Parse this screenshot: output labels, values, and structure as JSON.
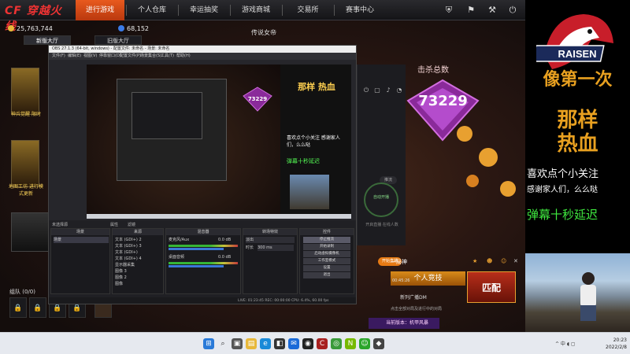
{
  "game": {
    "logo_text": "CF 穿越火线",
    "nav_tabs": [
      "进行游戏",
      "个人仓库",
      "幸运抽奖",
      "游戏商城",
      "交易所",
      "赛事中心"
    ],
    "active_tab_index": 0,
    "top_icons": [
      "shield-icon",
      "flag-icon",
      "wrench-icon",
      "power-icon"
    ],
    "currency": {
      "coins": "25,763,744",
      "points": "68,152"
    },
    "center_title": "传说女帝",
    "sub_tabs": [
      "新版大厅",
      "旧版大厅"
    ],
    "promo_1": "神兵觉醒\n限时",
    "promo_2": "地图工坊\n进行模式更新",
    "team_label": "组队 (0/0)",
    "kills_label": "击杀总数",
    "kills_value": "73229",
    "live_btn": "开始直播",
    "lobby": {
      "mode": "一局神",
      "personal": "个人竞技",
      "match": "匹配",
      "time": "00:45:26",
      "sub1": "新列广播DM",
      "sub2": "点击全部对局及进行中的对局",
      "version": "当前版本：机甲风暴"
    },
    "stream_panel": {
      "circle": "自动开播",
      "text": "开启直播\n在线人数",
      "small": "推流"
    }
  },
  "obs": {
    "title": "OBS 27.1.3 (64-bit, windows) - 配置文件: 未命名 - 场景: 未命名",
    "menu": [
      "文件(F)",
      "编辑(E)",
      "视图(V)",
      "停靠窗口(D)",
      "配置文件(P)",
      "场景集合(S)",
      "工具(T)",
      "帮助(H)"
    ],
    "dock_header_left": "未选择源",
    "dock_header_mid1": "属性",
    "dock_header_mid2": "滤镜",
    "columns": {
      "scenes": "场景",
      "sources": "来源",
      "mixer": "混音器",
      "transitions": "转场特效",
      "controls": "控件"
    },
    "scene_row": "场景",
    "sources": [
      "文本 (GDI+) 2",
      "文本 (GDI+) 3",
      "文本 (GDI+)",
      "文本 (GDI+) 4",
      "显示器采集",
      "图像 3",
      "图像 2",
      "图像"
    ],
    "mixer": [
      {
        "name": "麦克风/Aux",
        "db": "0.0 dB"
      },
      {
        "name": "桌面音频",
        "db": "0.0 dB"
      }
    ],
    "transition": {
      "type": "淡出",
      "duration_label": "时长",
      "duration": "300 ms"
    },
    "controls": [
      "停止推流",
      "开始录制",
      "启动虚拟摄像机",
      "工作室模式",
      "设置",
      "退出"
    ],
    "status": "LIVE: 01:23:45  REC: 00:00:00  CPU: 6.4%, 60.00 fps",
    "nested_kills": "73229",
    "nested_banner": {
      "text1": "那样\n热血",
      "text2": "喜欢点个小关注\n感谢家人们，么么哒",
      "text3": "弹幕十秒延迟"
    }
  },
  "overlay": {
    "team_name": "RAISEN",
    "big_text_1": "像第一次",
    "big_text_2": "那样\n热血",
    "line1": "喜欢点个小关注",
    "line2": "感谢家人们，么么哒",
    "line3": "弹幕十秒延迟"
  },
  "taskbar": {
    "icons": [
      "windows-icon",
      "search-icon",
      "taskview-icon",
      "explorer-icon",
      "edge-icon",
      "store-icon",
      "mail-icon",
      "obs-icon",
      "game-icon",
      "chrome-icon",
      "nvidia-icon",
      "wechat-icon",
      "app-icon"
    ],
    "tray": "^ 中 ◖ ▢",
    "time": "20:23",
    "date": "2022/2/8"
  }
}
